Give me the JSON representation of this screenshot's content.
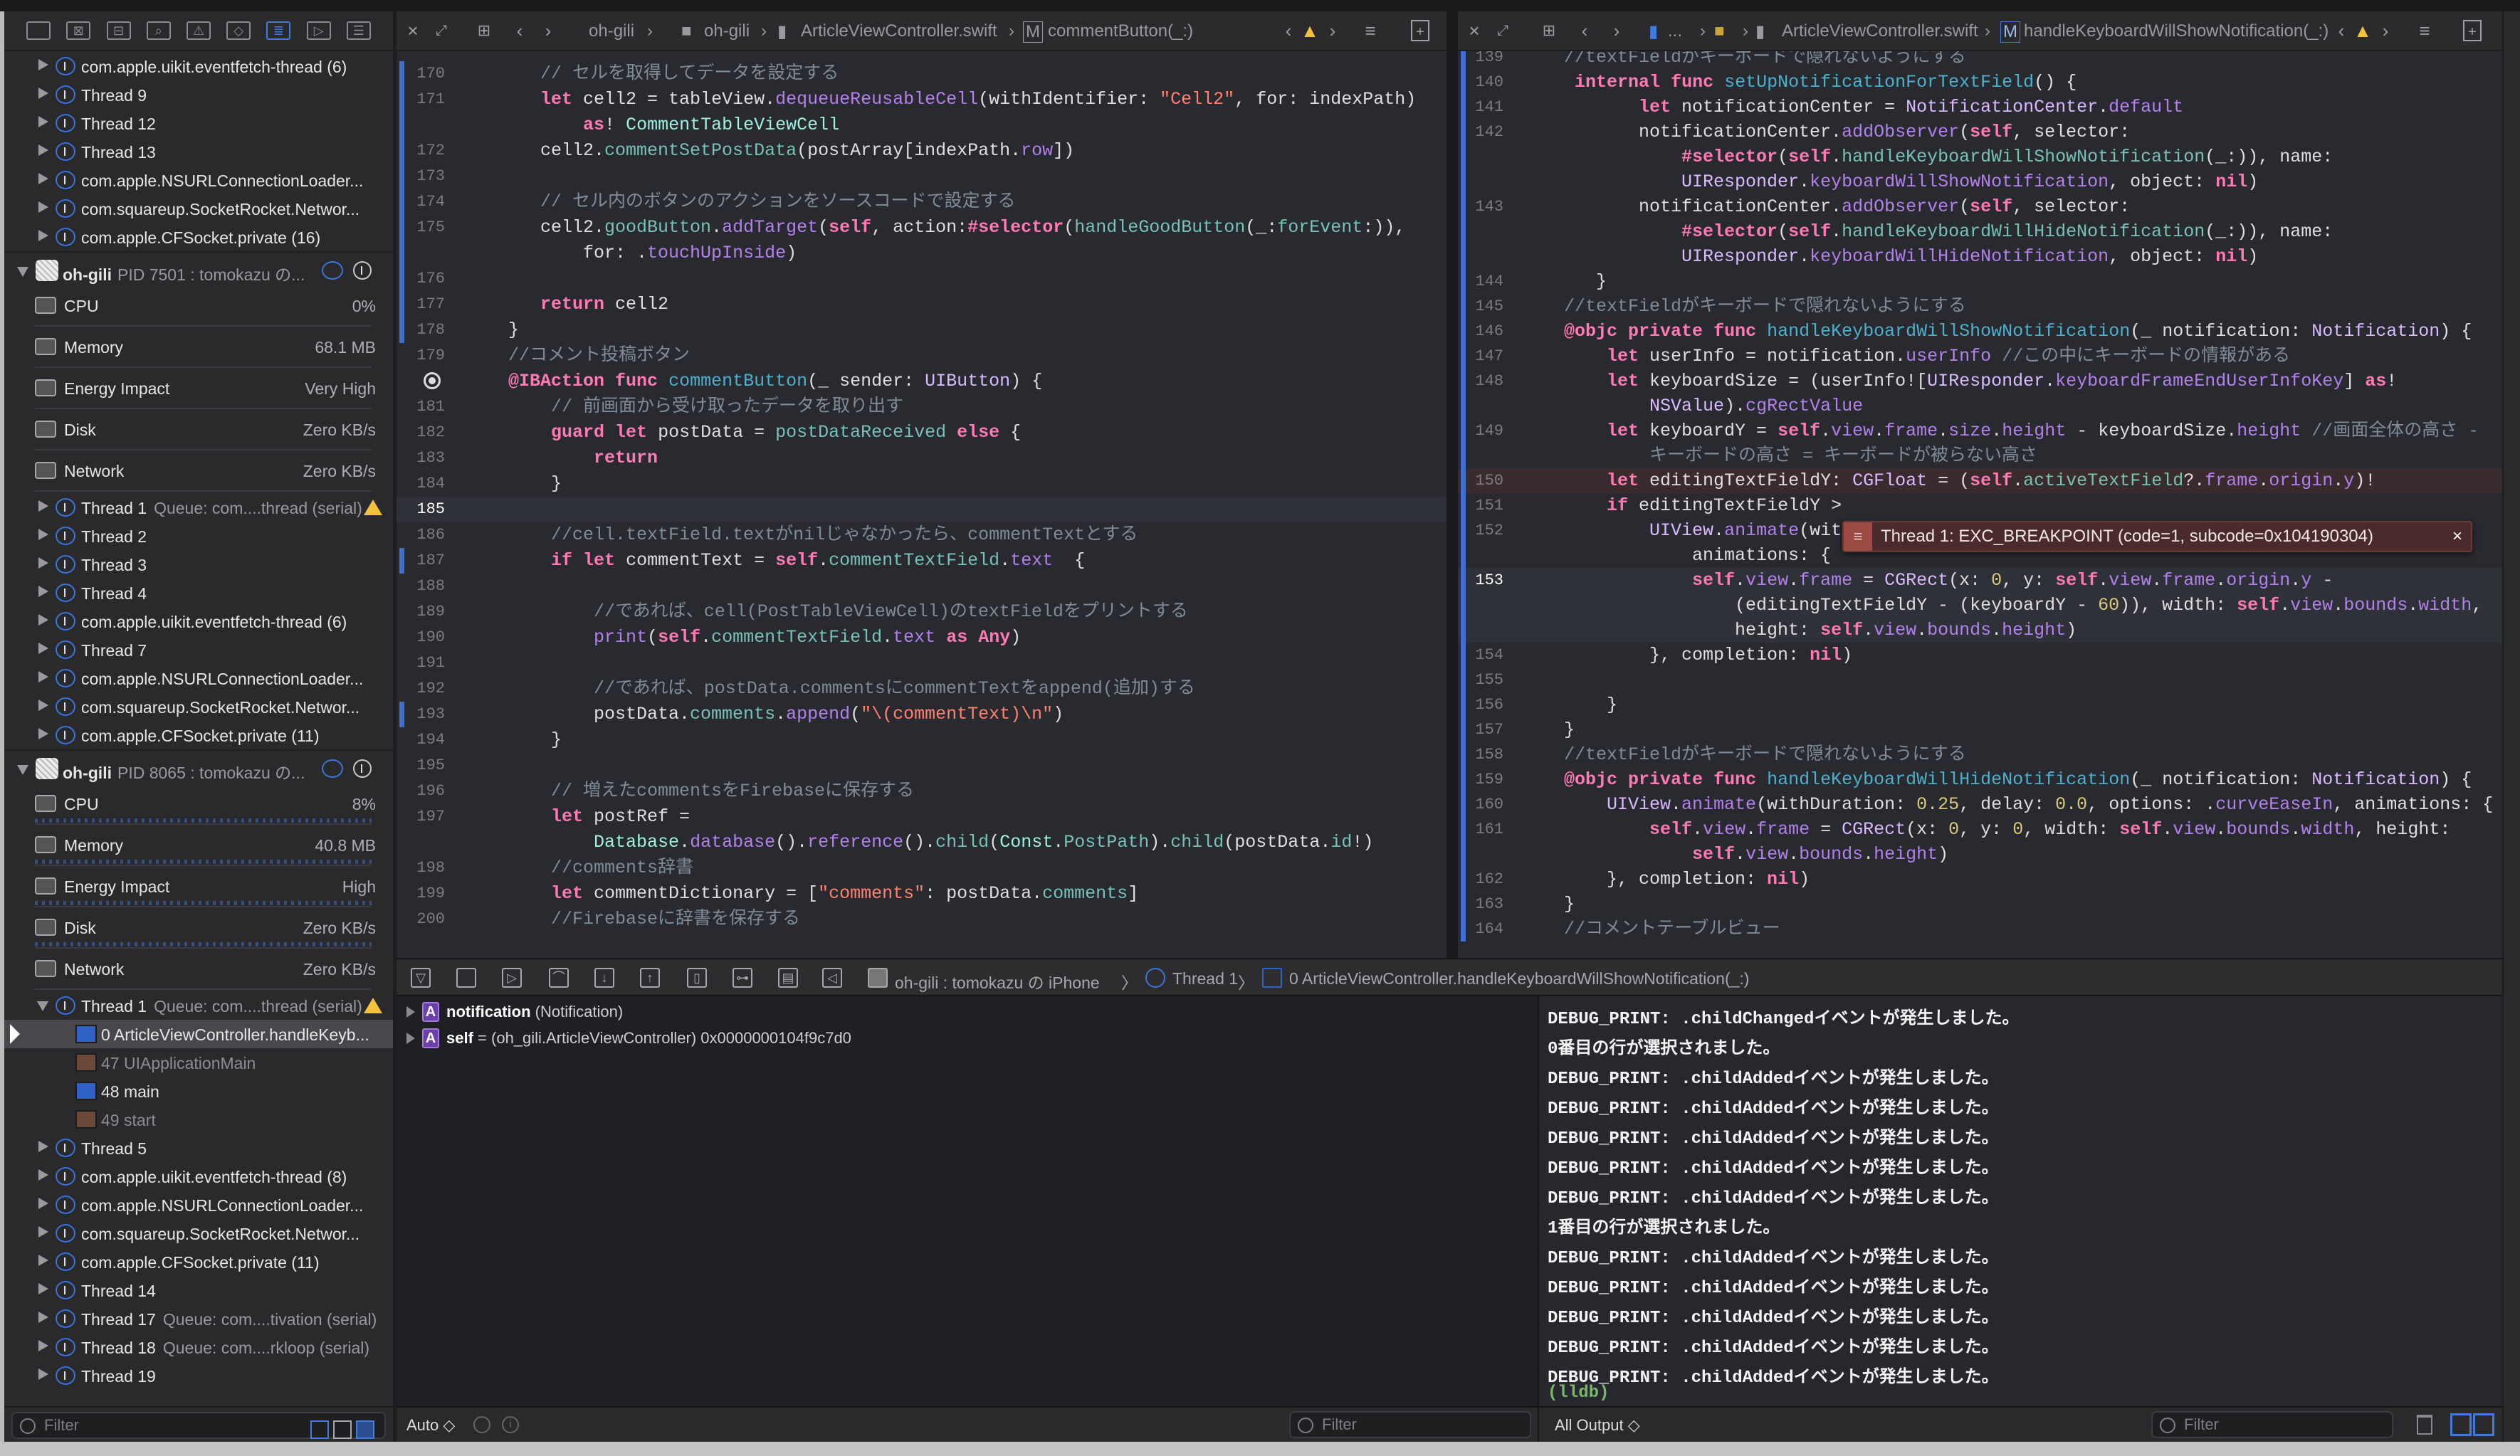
{
  "colors": {
    "accent": "#3f7be0",
    "editor_bg": "#292a30",
    "error": "#9c4a44",
    "warning": "#f5c33b",
    "lldb": "#79b86a"
  },
  "sidebar": {
    "nav_icons": [
      "folder-icon",
      "source-control-icon",
      "symbol-icon",
      "search-icon",
      "issue-warning-icon",
      "test-icon",
      "debug-navigator-icon",
      "breakpoint-icon",
      "report-icon"
    ],
    "rows": [
      {
        "type": "thread",
        "label": "com.apple.uikit.eventfetch-thread (6)"
      },
      {
        "type": "thread",
        "label": "Thread 9"
      },
      {
        "type": "thread",
        "label": "Thread 12"
      },
      {
        "type": "thread",
        "label": "Thread 13"
      },
      {
        "type": "thread",
        "label": "com.apple.NSURLConnectionLoader..."
      },
      {
        "type": "thread",
        "label": "com.squareup.SocketRocket.Networ..."
      },
      {
        "type": "thread",
        "label": "com.apple.CFSocket.private (16)"
      },
      {
        "type": "process",
        "name": "oh-gili",
        "detail": "PID 7501 : tomokazu の..."
      },
      {
        "type": "gauge",
        "label": "CPU",
        "value": "0%",
        "icon": "cpu-icon"
      },
      {
        "type": "gauge",
        "label": "Memory",
        "value": "68.1 MB",
        "icon": "memory-icon"
      },
      {
        "type": "gauge",
        "label": "Energy Impact",
        "value": "Very High",
        "icon": "battery-icon"
      },
      {
        "type": "gauge",
        "label": "Disk",
        "value": "Zero KB/s",
        "icon": "disk-icon"
      },
      {
        "type": "gauge",
        "label": "Network",
        "value": "Zero KB/s",
        "icon": "network-icon"
      },
      {
        "type": "thread",
        "label": "Thread 1",
        "queue": "Queue: com....thread (serial)",
        "warning": true
      },
      {
        "type": "thread",
        "label": "Thread 2"
      },
      {
        "type": "thread",
        "label": "Thread 3"
      },
      {
        "type": "thread",
        "label": "Thread 4"
      },
      {
        "type": "thread",
        "label": "com.apple.uikit.eventfetch-thread (6)"
      },
      {
        "type": "thread",
        "label": "Thread 7"
      },
      {
        "type": "thread",
        "label": "com.apple.NSURLConnectionLoader..."
      },
      {
        "type": "thread",
        "label": "com.squareup.SocketRocket.Networ..."
      },
      {
        "type": "thread",
        "label": "com.apple.CFSocket.private (11)"
      },
      {
        "type": "process",
        "name": "oh-gili",
        "detail": "PID 8065 : tomokazu の..."
      },
      {
        "type": "gauge",
        "label": "CPU",
        "value": "8%",
        "icon": "cpu-icon",
        "spark": true
      },
      {
        "type": "gauge",
        "label": "Memory",
        "value": "40.8 MB",
        "icon": "memory-icon",
        "spark": true
      },
      {
        "type": "gauge",
        "label": "Energy Impact",
        "value": "High",
        "icon": "battery-icon",
        "spark": true
      },
      {
        "type": "gauge",
        "label": "Disk",
        "value": "Zero KB/s",
        "icon": "disk-icon",
        "spark": true
      },
      {
        "type": "gauge",
        "label": "Network",
        "value": "Zero KB/s",
        "icon": "network-icon"
      },
      {
        "type": "thread",
        "label": "Thread 1",
        "queue": "Queue: com....thread (serial)",
        "warning": true,
        "expanded": true
      },
      {
        "type": "frame",
        "label": "0 ArticleViewController.handleKeyb...",
        "kind": "user",
        "selected": true
      },
      {
        "type": "frame",
        "label": "47 UIApplicationMain",
        "kind": "framework",
        "dim": true
      },
      {
        "type": "frame",
        "label": "48 main",
        "kind": "user"
      },
      {
        "type": "frame",
        "label": "49 start",
        "kind": "framework",
        "dim": true
      },
      {
        "type": "thread",
        "label": "Thread 5"
      },
      {
        "type": "thread",
        "label": "com.apple.uikit.eventfetch-thread (8)"
      },
      {
        "type": "thread",
        "label": "com.apple.NSURLConnectionLoader..."
      },
      {
        "type": "thread",
        "label": "com.squareup.SocketRocket.Networ..."
      },
      {
        "type": "thread",
        "label": "com.apple.CFSocket.private (11)"
      },
      {
        "type": "thread",
        "label": "Thread 14"
      },
      {
        "type": "thread",
        "label": "Thread 17",
        "queue": "Queue: com....tivation (serial)"
      },
      {
        "type": "thread",
        "label": "Thread 18",
        "queue": "Queue: com....rkloop (serial)"
      },
      {
        "type": "thread",
        "label": "Thread 19"
      }
    ],
    "filter_placeholder": "Filter"
  },
  "left_editor": {
    "breadcrumb": [
      "oh-gili",
      "oh-gili",
      "ArticleViewController.swift",
      "commentButton(_:)"
    ],
    "current_line": "185",
    "lines": [
      {
        "n": "170",
        "t": "   // セルを取得してデータを設定する",
        "c": 1
      },
      {
        "n": "171",
        "t": "   let cell2 = tableView.dequeueReusableCell(withIdentifier: \"Cell2\", for: indexPath)",
        "c": 1
      },
      {
        "n": "",
        "t": "       as! CommentTableViewCell",
        "c": 1
      },
      {
        "n": "172",
        "t": "   cell2.commentSetPostData(postArray[indexPath.row])",
        "c": 1
      },
      {
        "n": "173",
        "t": "",
        "c": 1
      },
      {
        "n": "174",
        "t": "   // セル内のボタンのアクションをソースコードで設定する",
        "c": 1
      },
      {
        "n": "175",
        "t": "   cell2.goodButton.addTarget(self, action:#selector(handleGoodButton(_:forEvent:)),",
        "c": 1
      },
      {
        "n": "",
        "t": "       for: .touchUpInside)",
        "c": 1
      },
      {
        "n": "176",
        "t": "",
        "c": 1
      },
      {
        "n": "177",
        "t": "   return cell2",
        "c": 1
      },
      {
        "n": "178",
        "t": "}",
        "c": 1
      },
      {
        "n": "179",
        "t": "//コメント投稿ボタン"
      },
      {
        "n": "",
        "t": "@IBAction func commentButton(_ sender: UIButton) {",
        "bp": 1
      },
      {
        "n": "181",
        "t": "    // 前画面から受け取ったデータを取り出す"
      },
      {
        "n": "182",
        "t": "    guard let postData = postDataReceived else {"
      },
      {
        "n": "183",
        "t": "        return"
      },
      {
        "n": "184",
        "t": "    }"
      },
      {
        "n": "185",
        "t": ""
      },
      {
        "n": "186",
        "t": "    //cell.textField.textがnilじゃなかったら、commentTextとする"
      },
      {
        "n": "187",
        "t": "    if let commentText = self.commentTextField.text  {",
        "c": 1
      },
      {
        "n": "188",
        "t": ""
      },
      {
        "n": "189",
        "t": "        //であれば、cell(PostTableViewCell)のtextFieldをプリントする"
      },
      {
        "n": "190",
        "t": "        print(self.commentTextField.text as Any)"
      },
      {
        "n": "191",
        "t": ""
      },
      {
        "n": "192",
        "t": "        //であれば、postData.commentsにcommentTextをappend(追加)する"
      },
      {
        "n": "193",
        "t": "        postData.comments.append(\"\\(commentText)\\n\")",
        "c": 1
      },
      {
        "n": "194",
        "t": "    }"
      },
      {
        "n": "195",
        "t": ""
      },
      {
        "n": "196",
        "t": "    // 増えたcommentsをFirebaseに保存する"
      },
      {
        "n": "197",
        "t": "    let postRef ="
      },
      {
        "n": "",
        "t": "        Database.database().reference().child(Const.PostPath).child(postData.id!)"
      },
      {
        "n": "198",
        "t": "    //comments辞書"
      },
      {
        "n": "199",
        "t": "    let commentDictionary = [\"comments\": postData.comments]"
      },
      {
        "n": "200",
        "t": "    //Firebaseに辞書を保存する"
      }
    ]
  },
  "right_editor": {
    "breadcrumb": [
      "...",
      "ArticleViewController.swift",
      "handleKeyboardWillShowNotification(_:)"
    ],
    "current_line": "153",
    "error_line": "150",
    "error_message": "Thread 1: EXC_BREAKPOINT (code=1, subcode=0x104190304)",
    "error_close": "×",
    "lines": [
      {
        "n": "139",
        "t": "//textFieldがキーボードで隠れないようにする"
      },
      {
        "n": "140",
        "t": " internal func setUpNotificationForTextField() {"
      },
      {
        "n": "141",
        "t": "       let notificationCenter = NotificationCenter.default"
      },
      {
        "n": "142",
        "t": "       notificationCenter.addObserver(self, selector:"
      },
      {
        "n": "",
        "t": "           #selector(self.handleKeyboardWillShowNotification(_:)), name:"
      },
      {
        "n": "",
        "t": "           UIResponder.keyboardWillShowNotification, object: nil)"
      },
      {
        "n": "143",
        "t": "       notificationCenter.addObserver(self, selector:"
      },
      {
        "n": "",
        "t": "           #selector(self.handleKeyboardWillHideNotification(_:)), name:"
      },
      {
        "n": "",
        "t": "           UIResponder.keyboardWillHideNotification, object: nil)"
      },
      {
        "n": "144",
        "t": "   }"
      },
      {
        "n": "145",
        "t": "//textFieldがキーボードで隠れないようにする"
      },
      {
        "n": "146",
        "t": "@objc private func handleKeyboardWillShowNotification(_ notification: Notification) {"
      },
      {
        "n": "147",
        "t": "    let userInfo = notification.userInfo //この中にキーボードの情報がある"
      },
      {
        "n": "148",
        "t": "    let keyboardSize = (userInfo![UIResponder.keyboardFrameEndUserInfoKey] as!"
      },
      {
        "n": "",
        "t": "        NSValue).cgRectValue"
      },
      {
        "n": "149",
        "t": "    let keyboardY = self.view.frame.size.height - keyboardSize.height //画面全体の高さ -"
      },
      {
        "n": "",
        "t": "        キーボードの高さ = キーボードが被らない高さ"
      },
      {
        "n": "150",
        "t": "    let editingTextFieldY: CGFloat = (self.activeTextField?.frame.origin.y)!"
      },
      {
        "n": "151",
        "t": "    if editingTextFieldY >"
      },
      {
        "n": "152",
        "t": "        UIView.animate(withDuration: 0.25, delay: 0.0, options: .curveEaseIn,"
      },
      {
        "n": "",
        "t": "            animations: {"
      },
      {
        "n": "153",
        "t": "            self.view.frame = CGRect(x: 0, y: self.view.frame.origin.y -"
      },
      {
        "n": "",
        "t": "                (editingTextFieldY - (keyboardY - 60)), width: self.view.bounds.width,"
      },
      {
        "n": "",
        "t": "                height: self.view.bounds.height)"
      },
      {
        "n": "154",
        "t": "        }, completion: nil)"
      },
      {
        "n": "155",
        "t": ""
      },
      {
        "n": "156",
        "t": "    }"
      },
      {
        "n": "157",
        "t": "}"
      },
      {
        "n": "158",
        "t": "//textFieldがキーボードで隠れないようにする"
      },
      {
        "n": "159",
        "t": "@objc private func handleKeyboardWillHideNotification(_ notification: Notification) {"
      },
      {
        "n": "160",
        "t": "    UIView.animate(withDuration: 0.25, delay: 0.0, options: .curveEaseIn, animations: {"
      },
      {
        "n": "161",
        "t": "        self.view.frame = CGRect(x: 0, y: 0, width: self.view.bounds.width, height:"
      },
      {
        "n": "",
        "t": "            self.view.bounds.height)"
      },
      {
        "n": "162",
        "t": "    }, completion: nil)"
      },
      {
        "n": "163",
        "t": "}"
      },
      {
        "n": "164",
        "t": "//コメントテーブルビュー"
      }
    ]
  },
  "debug_bar": {
    "icons": [
      "hide-debug-area-icon",
      "breakpoints-toggle-icon",
      "continue-icon",
      "step-over-icon",
      "step-into-icon",
      "step-out-icon",
      "view-hierarchy-icon",
      "memory-graph-icon",
      "environment-overrides-icon",
      "simulate-location-icon"
    ],
    "path": [
      "oh-gili : tomokazu の iPhone",
      "Thread 1",
      "0 ArticleViewController.handleKeyboardWillShowNotification(_:)"
    ]
  },
  "variables": {
    "rows": [
      {
        "name": "notification",
        "detail": "(Notification)"
      },
      {
        "name": "self",
        "detail": "= (oh_gili.ArticleViewController) 0x0000000104f9c7d0"
      }
    ],
    "scope": "Auto ◇",
    "filter_placeholder": "Filter"
  },
  "console": {
    "lines": [
      "DEBUG_PRINT: .childChangedイベントが発生しました。",
      "0番目の行が選択されました。",
      "DEBUG_PRINT: .childAddedイベントが発生しました。",
      "DEBUG_PRINT: .childAddedイベントが発生しました。",
      "DEBUG_PRINT: .childAddedイベントが発生しました。",
      "DEBUG_PRINT: .childAddedイベントが発生しました。",
      "DEBUG_PRINT: .childAddedイベントが発生しました。",
      "1番目の行が選択されました。",
      "DEBUG_PRINT: .childAddedイベントが発生しました。",
      "DEBUG_PRINT: .childAddedイベントが発生しました。",
      "DEBUG_PRINT: .childAddedイベントが発生しました。",
      "DEBUG_PRINT: .childAddedイベントが発生しました。",
      "DEBUG_PRINT: .childAddedイベントが発生しました。"
    ],
    "prompt": "(lldb)",
    "output_selector": "All Output ◇",
    "filter_placeholder": "Filter"
  }
}
